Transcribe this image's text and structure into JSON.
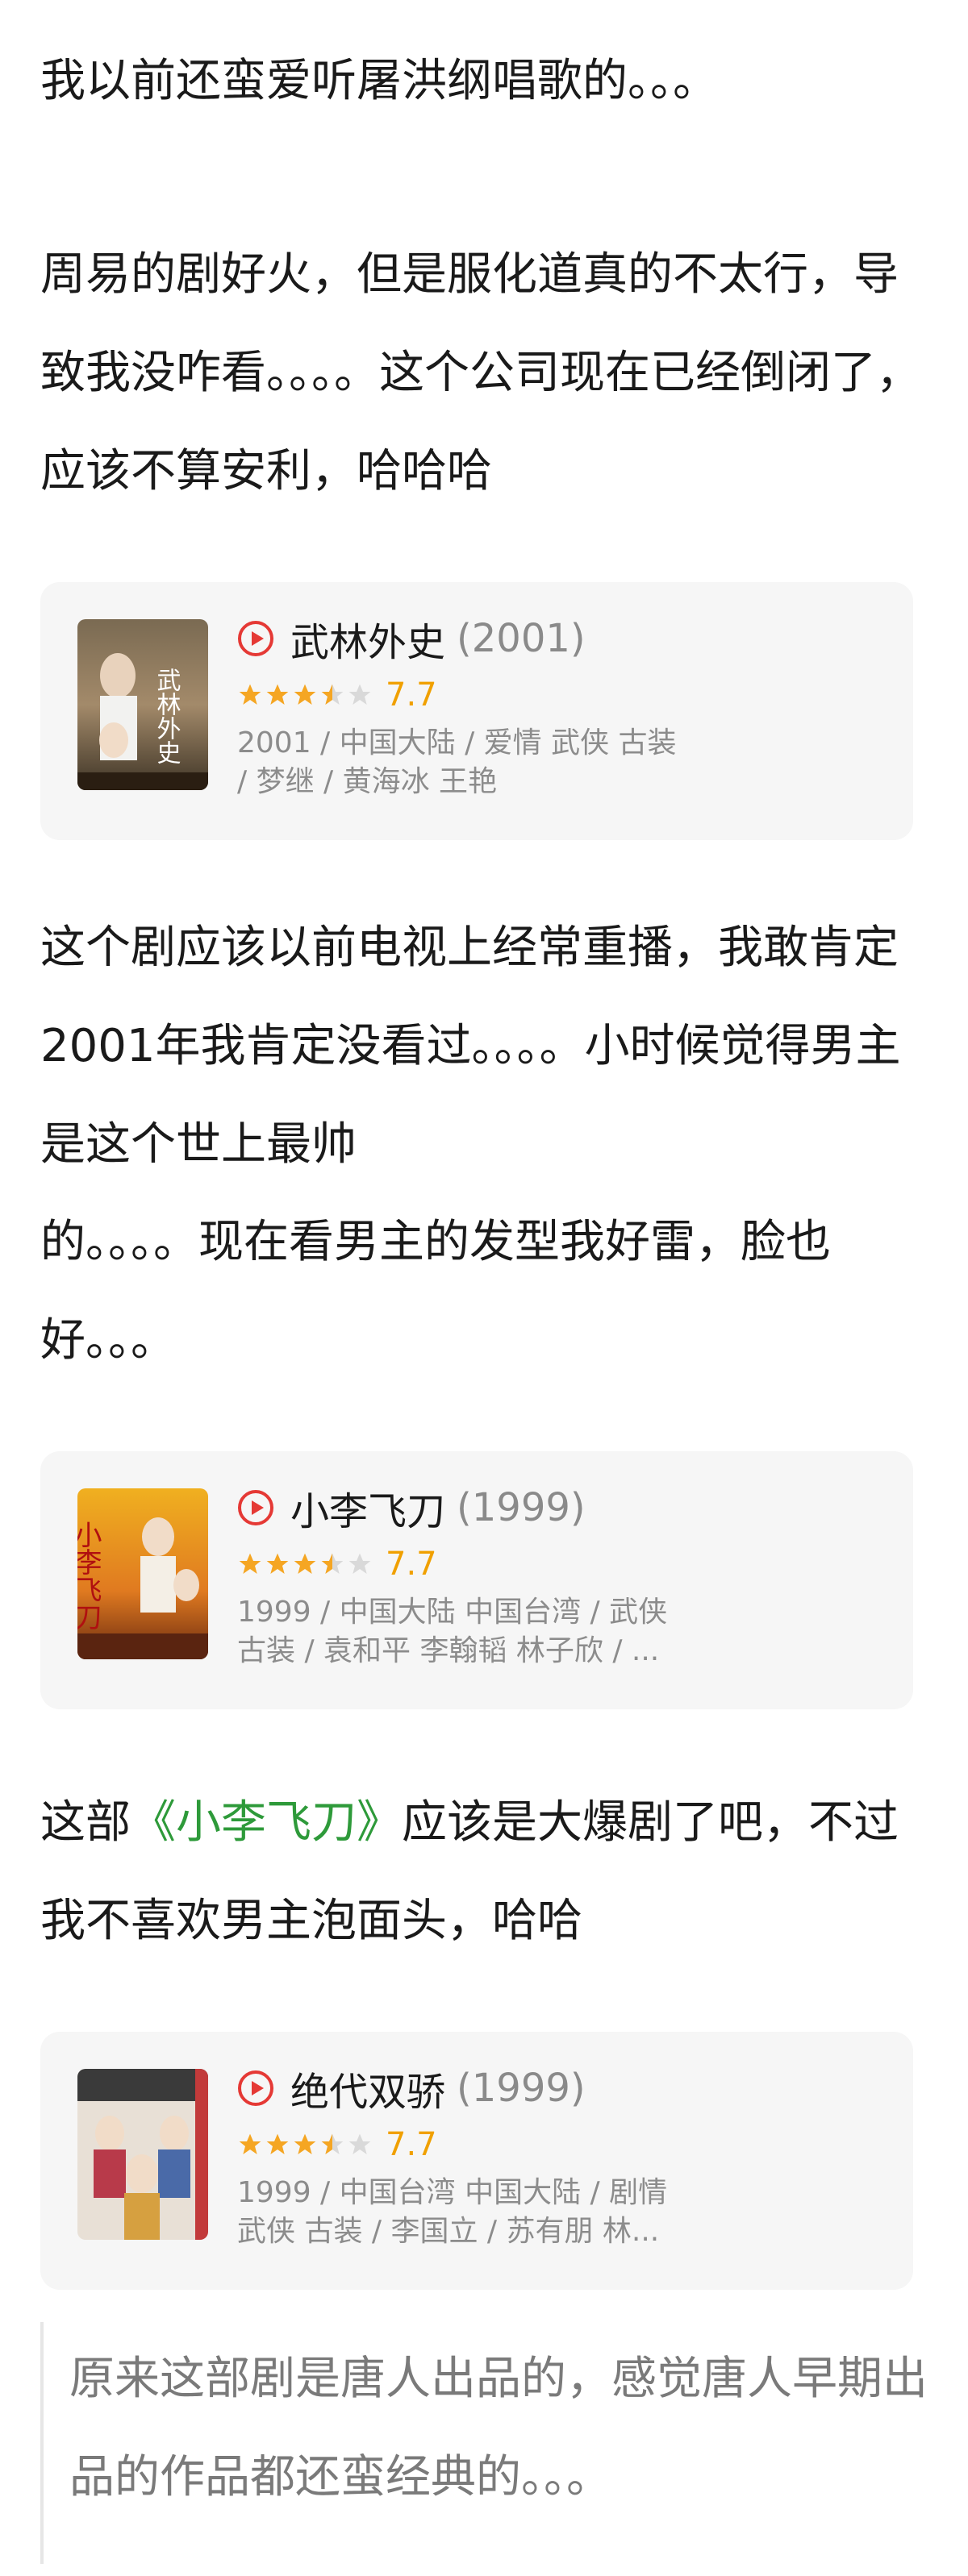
{
  "paragraphs": {
    "p1": "我以前还蛮爱听屠洪纲唱歌的。。。",
    "p2": "周易的剧好火，但是服化道真的不太行，导致我没咋看。。。。这个公司现在已经倒闭了，应该不算安利，哈哈哈",
    "p3": "这个剧应该以前电视上经常重播，我敢肯定2001年我肯定没看过。。。。小时候觉得男主是这个世上最帅",
    "p3b": "的。。。。现在看男主的发型我好雷，脸也好。。。",
    "p4_prefix": "这部",
    "p4_link": "《小李飞刀》",
    "p4_suffix": "应该是大爆剧了吧，不过我不喜欢男主泡面头，哈哈"
  },
  "cards": [
    {
      "title": "武林外史",
      "year": "(2001)",
      "score": "7.7",
      "stars": 3.5,
      "meta_line1": "2001 / 中国大陆 / 爱情 武侠 古装",
      "meta_line2": "/ 梦继 / 黄海冰 王艳",
      "poster_text": "武林外史",
      "play_icon": "play-circle-icon"
    },
    {
      "title": "小李飞刀",
      "year": "(1999)",
      "score": "7.7",
      "stars": 3.5,
      "meta_line1": "1999 / 中国大陆 中国台湾 / 武侠",
      "meta_line2": "古装 / 袁和平 李翰韬 林子欣 / ...",
      "poster_text": "小李飞刀",
      "play_icon": "play-circle-icon"
    },
    {
      "title": "绝代双骄",
      "year": "(1999)",
      "score": "7.7",
      "stars": 3.5,
      "meta_line1": "1999 / 中国台湾 中国大陆 / 剧情",
      "meta_line2": "武侠 古装 / 李国立 / 苏有朋 林...",
      "poster_text": "",
      "play_icon": "play-circle-icon"
    }
  ],
  "quote": "原来这部剧是唐人出品的，感觉唐人早期出品的作品都还蛮经典的。。。",
  "colors": {
    "text": "#1a1a1a",
    "link": "#2e9a3a",
    "star": "#f5a623",
    "score": "#f0a000",
    "play": "#e53935",
    "card_bg": "#f6f6f6"
  }
}
